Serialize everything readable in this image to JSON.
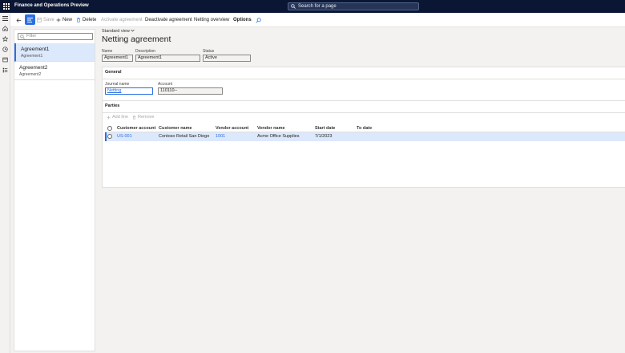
{
  "app": {
    "title": "Finance and Operations Preview"
  },
  "search": {
    "placeholder": "Search for a page"
  },
  "actions": {
    "save": "Save",
    "new": "New",
    "delete": "Delete",
    "activate": "Activate agreement",
    "deactivate": "Deactivate agreement",
    "netting_overview": "Netting overview",
    "options": "Options"
  },
  "list": {
    "filter_placeholder": "Filter",
    "items": [
      {
        "title": "Agreement1",
        "subtitle": "Agreement1"
      },
      {
        "title": "Agreement2",
        "subtitle": "Agreement2"
      }
    ]
  },
  "page": {
    "view": "Standard view",
    "title": "Netting agreement",
    "fields": {
      "name_label": "Name",
      "name_value": "Agreement1",
      "description_label": "Description",
      "description_value": "Agreement1",
      "status_label": "Status",
      "status_value": "Active"
    }
  },
  "general": {
    "title": "General",
    "journal_label": "Journal name",
    "journal_value": "Netting",
    "account_label": "Account",
    "account_value": "110110--"
  },
  "parties": {
    "title": "Parties",
    "add_line": "Add line",
    "remove": "Remove",
    "columns": [
      "Customer account",
      "Customer name",
      "Vendor account",
      "Vendor name",
      "Start date",
      "To date"
    ],
    "rows": [
      [
        "US-001",
        "Contoso Retail San Diego",
        "1001",
        "Acme Office Supplies",
        "7/1/2023",
        ""
      ]
    ]
  },
  "colors": {
    "topbar": "#0a1633",
    "accent": "#2b6fe0",
    "selection": "#dce8fb"
  },
  "icons": [
    "waffle-icon",
    "search-icon",
    "hamburger-icon",
    "home-icon",
    "star-icon",
    "clock-icon",
    "workspace-icon",
    "list-icon",
    "back-icon",
    "save-icon",
    "plus-icon",
    "trash-icon",
    "chevron-down-icon",
    "filter-icon"
  ]
}
